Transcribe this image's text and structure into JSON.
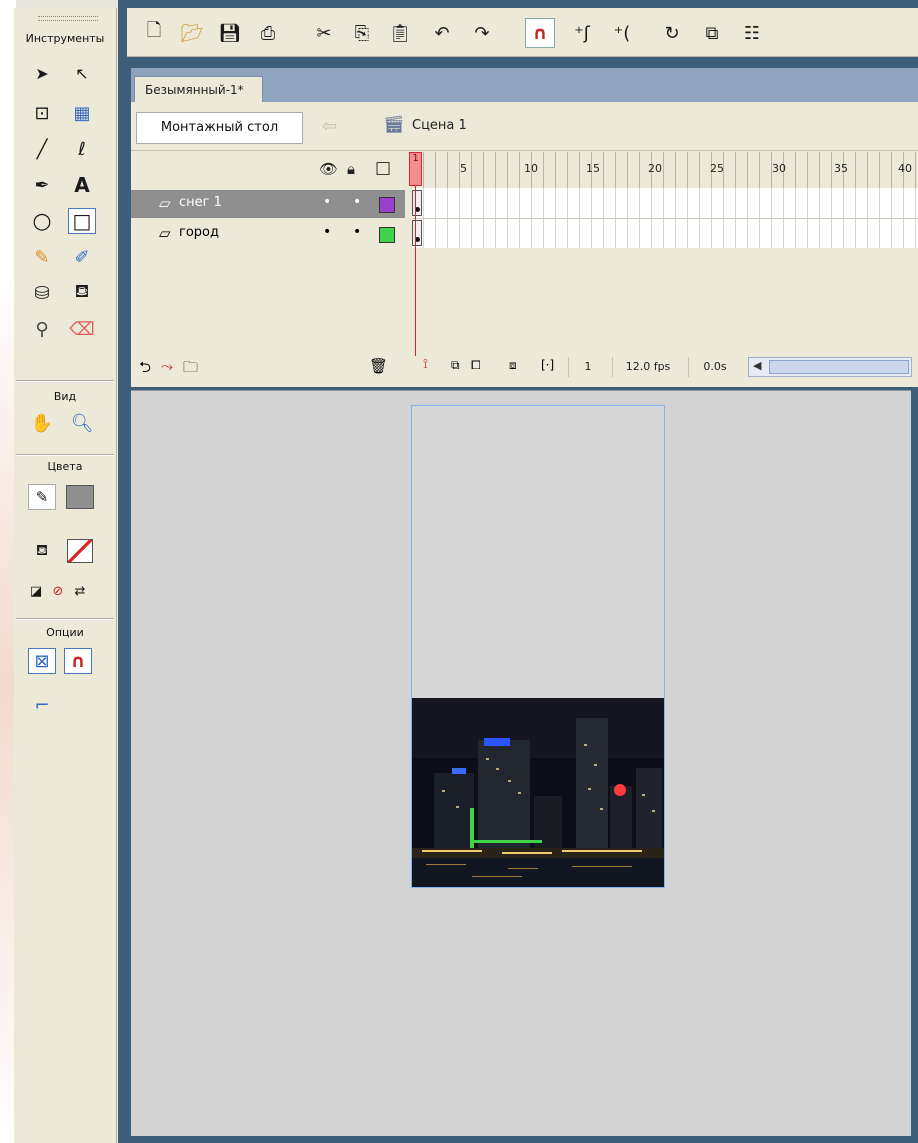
{
  "tools_panel": {
    "title": "Инструменты",
    "tools": [
      {
        "name": "selection-tool",
        "glyph": "➤"
      },
      {
        "name": "subselection-tool",
        "glyph": "↖"
      },
      {
        "name": "free-transform-tool",
        "glyph": "⊡"
      },
      {
        "name": "gradient-transform-tool",
        "glyph": "▦"
      },
      {
        "name": "line-tool",
        "glyph": "╱"
      },
      {
        "name": "lasso-tool",
        "glyph": "ℒ"
      },
      {
        "name": "pen-tool",
        "glyph": "✒"
      },
      {
        "name": "text-tool",
        "glyph": "A"
      },
      {
        "name": "oval-tool",
        "glyph": "○"
      },
      {
        "name": "rectangle-tool",
        "glyph": "□"
      },
      {
        "name": "pencil-tool",
        "glyph": "✎"
      },
      {
        "name": "brush-tool",
        "glyph": "🖌"
      },
      {
        "name": "ink-bottle-tool",
        "glyph": "⛁"
      },
      {
        "name": "paint-bucket-tool",
        "glyph": "⛾"
      },
      {
        "name": "eyedropper-tool",
        "glyph": "⚲"
      },
      {
        "name": "eraser-tool",
        "glyph": "⌫"
      }
    ],
    "view_label": "Вид",
    "colors_label": "Цвета",
    "options_label": "Опции"
  },
  "toolbar": {
    "buttons": [
      "new",
      "open",
      "save",
      "print",
      "cut",
      "copy",
      "paste",
      "undo",
      "redo",
      "snap-magnet",
      "smooth",
      "straighten",
      "rotate",
      "scale",
      "align"
    ]
  },
  "document": {
    "tab_title": "Безымянный-1*",
    "stage_button": "Монтажный стол",
    "scene_label": "Сцена 1"
  },
  "timeline": {
    "layers": [
      {
        "name": "снег 1",
        "active": true,
        "color": "#9b3fd0"
      },
      {
        "name": "город",
        "active": false,
        "color": "#3fd34a"
      }
    ],
    "ruler_ticks": [
      "1",
      "5",
      "10",
      "15",
      "20",
      "25",
      "30",
      "35",
      "40"
    ],
    "current_frame": "1",
    "fps": "12.0 fps",
    "time": "0.0s"
  }
}
